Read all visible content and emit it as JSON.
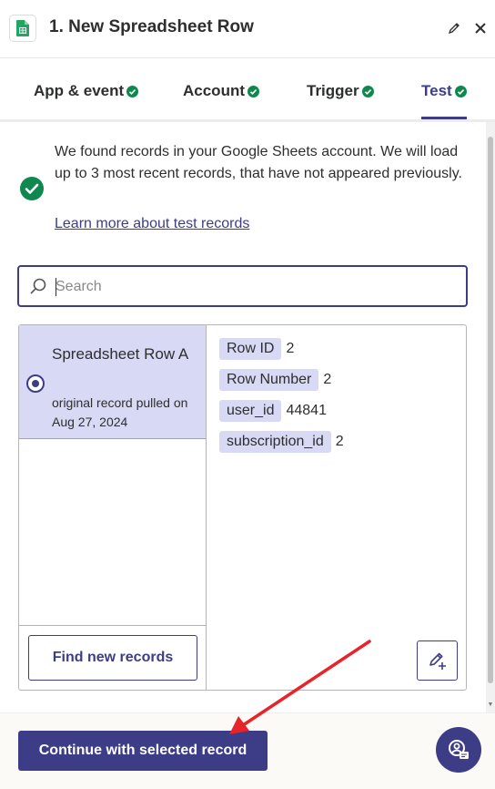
{
  "header": {
    "title": "1. New Spreadsheet Row",
    "app_icon": "google-sheets-icon",
    "edit_icon": "pencil-icon",
    "close_icon": "close-icon"
  },
  "tabs": [
    {
      "label": "App & event",
      "complete": true
    },
    {
      "label": "Account",
      "complete": true
    },
    {
      "label": "Trigger",
      "complete": true
    },
    {
      "label": "Test",
      "complete": true,
      "active": true
    }
  ],
  "info": {
    "message": "We found records in your Google Sheets account. We will load up to 3 most recent records, that have not appeared previously.",
    "link": "Learn more about test records"
  },
  "search": {
    "placeholder": "Search",
    "value": ""
  },
  "records": [
    {
      "title": "Spreadsheet Row A",
      "subtitle": "original record pulled on Aug 27, 2024",
      "selected": true
    }
  ],
  "record_fields": [
    {
      "key": "Row ID",
      "value": "2"
    },
    {
      "key": "Row Number",
      "value": "2"
    },
    {
      "key": "user_id",
      "value": "44841"
    },
    {
      "key": "subscription_id",
      "value": "2"
    }
  ],
  "buttons": {
    "find_new": "Find new records",
    "continue": "Continue with selected record"
  },
  "colors": {
    "brand": "#3d3d87",
    "success": "#0f884e",
    "selected_bg": "#d7d9f5",
    "annotation_arrow": "#e8242a"
  }
}
